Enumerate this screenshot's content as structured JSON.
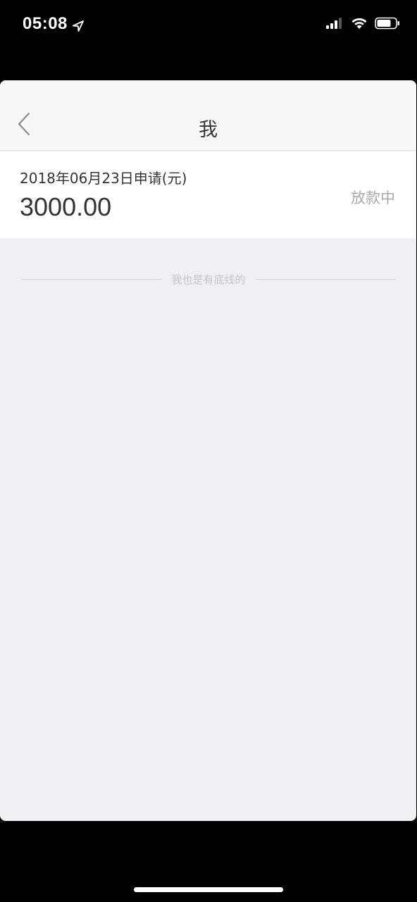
{
  "status_bar": {
    "time": "05:08",
    "location_icon": "location-arrow-icon",
    "signal_icon": "cellular-signal-icon",
    "wifi_icon": "wifi-icon",
    "battery_icon": "battery-icon"
  },
  "nav": {
    "title": "我",
    "back_icon": "chevron-left-icon"
  },
  "record": {
    "date_label": "2018年06月23日申请(元)",
    "amount": "3000.00",
    "status": "放款中"
  },
  "footer": {
    "end_text": "我也是有底线的"
  },
  "colors": {
    "background": "#efeff4",
    "nav_background": "#f8f8f8",
    "card_background": "#ffffff",
    "status_text": "#a9a9a9",
    "primary_text": "#333333"
  }
}
